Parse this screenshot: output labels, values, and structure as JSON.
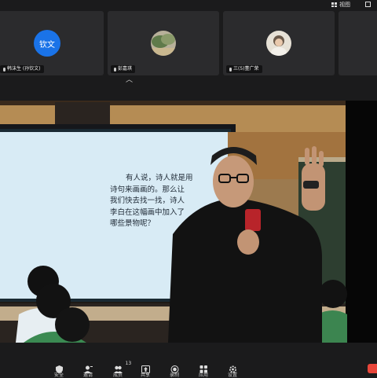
{
  "topbar": {
    "view_label": "视图"
  },
  "participants": [
    {
      "initials": "钦文",
      "name": "韩沫生 (孙钦文)",
      "avatar_color": "#1a73e8"
    },
    {
      "name": "彭嘉琪"
    },
    {
      "name": "三(5)董广荣"
    }
  ],
  "slide": {
    "lines": [
      "有人说，诗人就是用",
      "诗句来画画的。那么让",
      "我们快去找一找，诗人",
      "李白在这幅画中加入了",
      "哪些景物呢？"
    ]
  },
  "toolbar": {
    "items": [
      {
        "icon": "shield-icon",
        "label": "安全"
      },
      {
        "icon": "invite-icon",
        "label": "邀请"
      },
      {
        "icon": "participants-icon",
        "label": "成员",
        "count": "13"
      },
      {
        "icon": "share-screen-icon",
        "label": "共享"
      },
      {
        "icon": "record-icon",
        "label": "录制"
      },
      {
        "icon": "apps-icon",
        "label": "应用"
      },
      {
        "icon": "settings-icon",
        "label": "设置"
      }
    ]
  },
  "colors": {
    "accent": "#1a73e8",
    "end_meeting": "#e8463a",
    "slide_bg": "#d8ebf5"
  }
}
